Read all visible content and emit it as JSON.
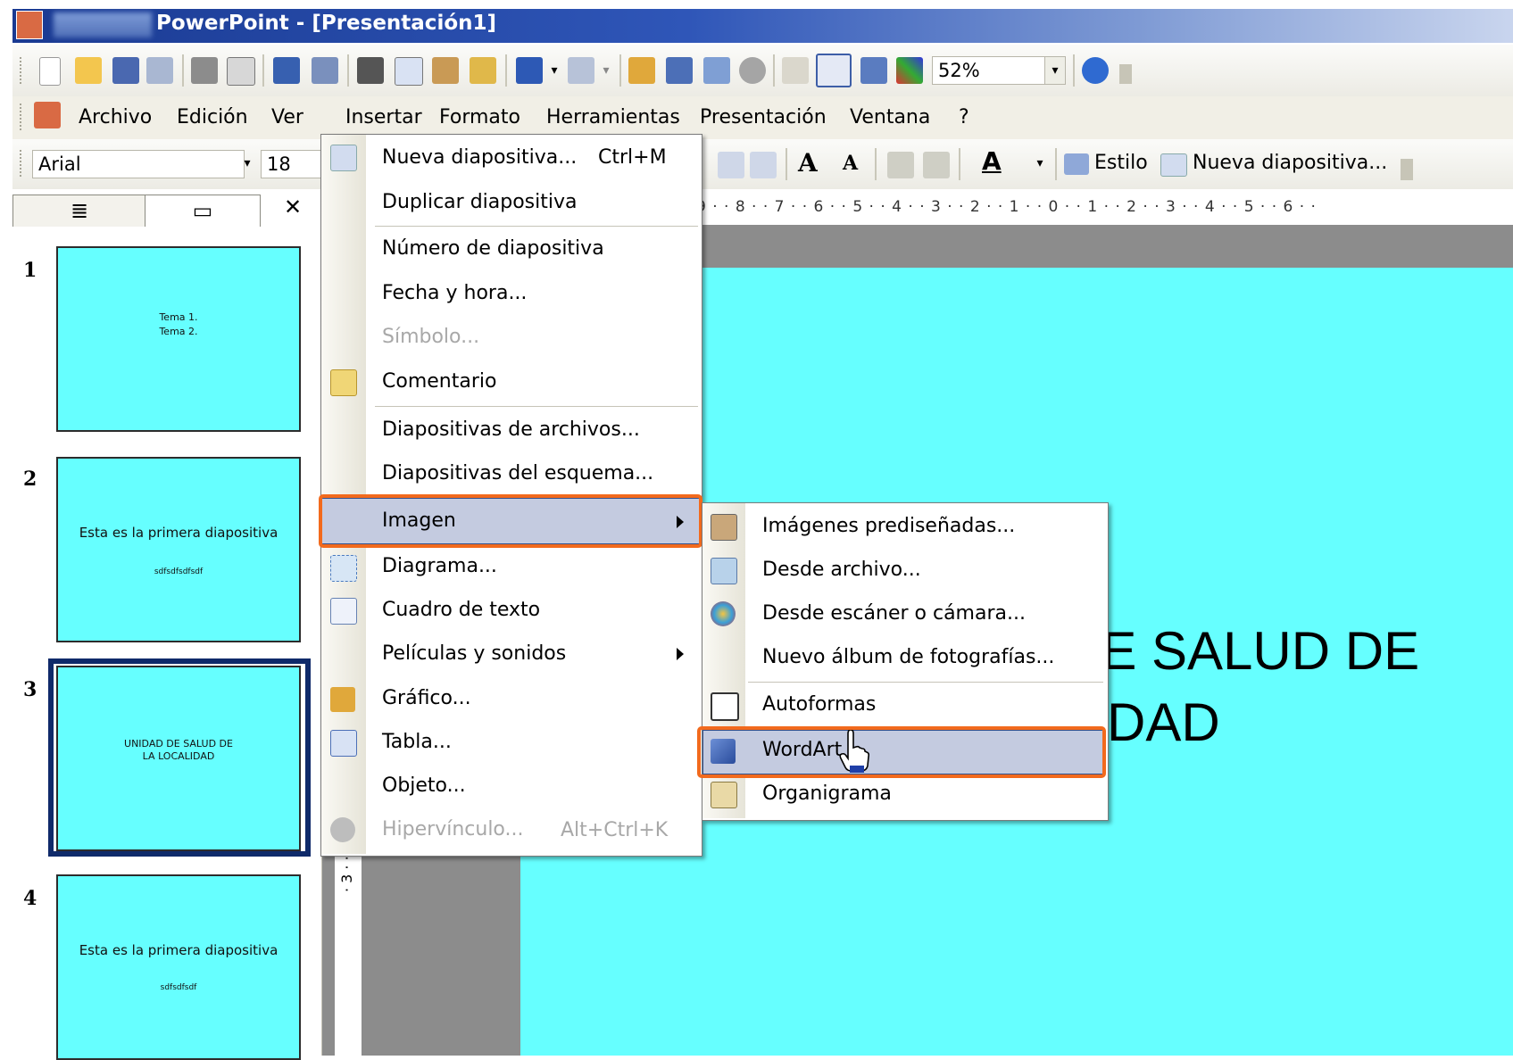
{
  "window": {
    "title": "PowerPoint - [Presentación1]"
  },
  "toolbar": {
    "zoom": "52%"
  },
  "menubar": {
    "items": [
      {
        "label": "Archivo",
        "name": "archivo"
      },
      {
        "label": "Edición",
        "name": "edicion"
      },
      {
        "label": "Ver",
        "name": "ver"
      },
      {
        "label": "Insertar",
        "name": "insertar"
      },
      {
        "label": "Formato",
        "name": "formato"
      },
      {
        "label": "Herramientas",
        "name": "herramientas"
      },
      {
        "label": "Presentación",
        "name": "presentacion"
      },
      {
        "label": "Ventana",
        "name": "ventana"
      },
      {
        "label": "?",
        "name": "ayuda"
      }
    ]
  },
  "format_toolbar": {
    "font": "Arial",
    "size": "18",
    "estilo_label": "Estilo",
    "nueva_diapositiva_label": "Nueva diapositiva..."
  },
  "ruler": {
    "top": "9 · · 8 · · 7 · · 6 · · 5 · · 4 · · 3 · · 2 · · 1 · · 0 · · 1 · · 2 · · 3 · · 4 · · 5 · · 6 · ·",
    "vertical": "· 3 · · 4 · · 5 · ·"
  },
  "slides": [
    {
      "num": "1",
      "lines": [
        "Tema 1.",
        "Tema 2."
      ]
    },
    {
      "num": "2",
      "lines": [
        "Esta es la primera diapositiva",
        "sdfsdfsdfsdf"
      ]
    },
    {
      "num": "3",
      "lines": [
        "UNIDAD DE SALUD DE",
        "LA LOCALIDAD"
      ]
    },
    {
      "num": "4",
      "lines": [
        "Esta es la primera diapositiva",
        "sdfsdfsdf"
      ]
    }
  ],
  "canvas": {
    "line1": "DE SALUD DE",
    "line2": "LIDAD"
  },
  "insert_menu": {
    "nueva_diapositiva": "Nueva diapositiva...",
    "nueva_diapositiva_shortcut": "Ctrl+M",
    "duplicar": "Duplicar diapositiva",
    "numero": "Número de diapositiva",
    "fecha": "Fecha y hora...",
    "simbolo": "Símbolo...",
    "comentario": "Comentario",
    "diap_archivos": "Diapositivas de archivos...",
    "diap_esquema": "Diapositivas del esquema...",
    "imagen": "Imagen",
    "diagrama": "Diagrama...",
    "cuadro_texto": "Cuadro de texto",
    "peliculas": "Películas y sonidos",
    "grafico": "Gráfico...",
    "tabla": "Tabla...",
    "objeto": "Objeto...",
    "hipervinculo": "Hipervínculo...",
    "hipervinculo_shortcut": "Alt+Ctrl+K"
  },
  "image_submenu": {
    "predisenadas": "Imágenes prediseñadas...",
    "desde_archivo": "Desde archivo...",
    "escaner": "Desde escáner o cámara...",
    "album": "Nuevo álbum de fotografías...",
    "autoformas": "Autoformas",
    "wordart": "WordArt",
    "organigrama": "Organigrama"
  },
  "colors": {
    "slide_bg": "#66ffff",
    "highlight": "#c4cbe0",
    "annotation": "#f26a1d",
    "title_bar": "#1a3a92"
  }
}
